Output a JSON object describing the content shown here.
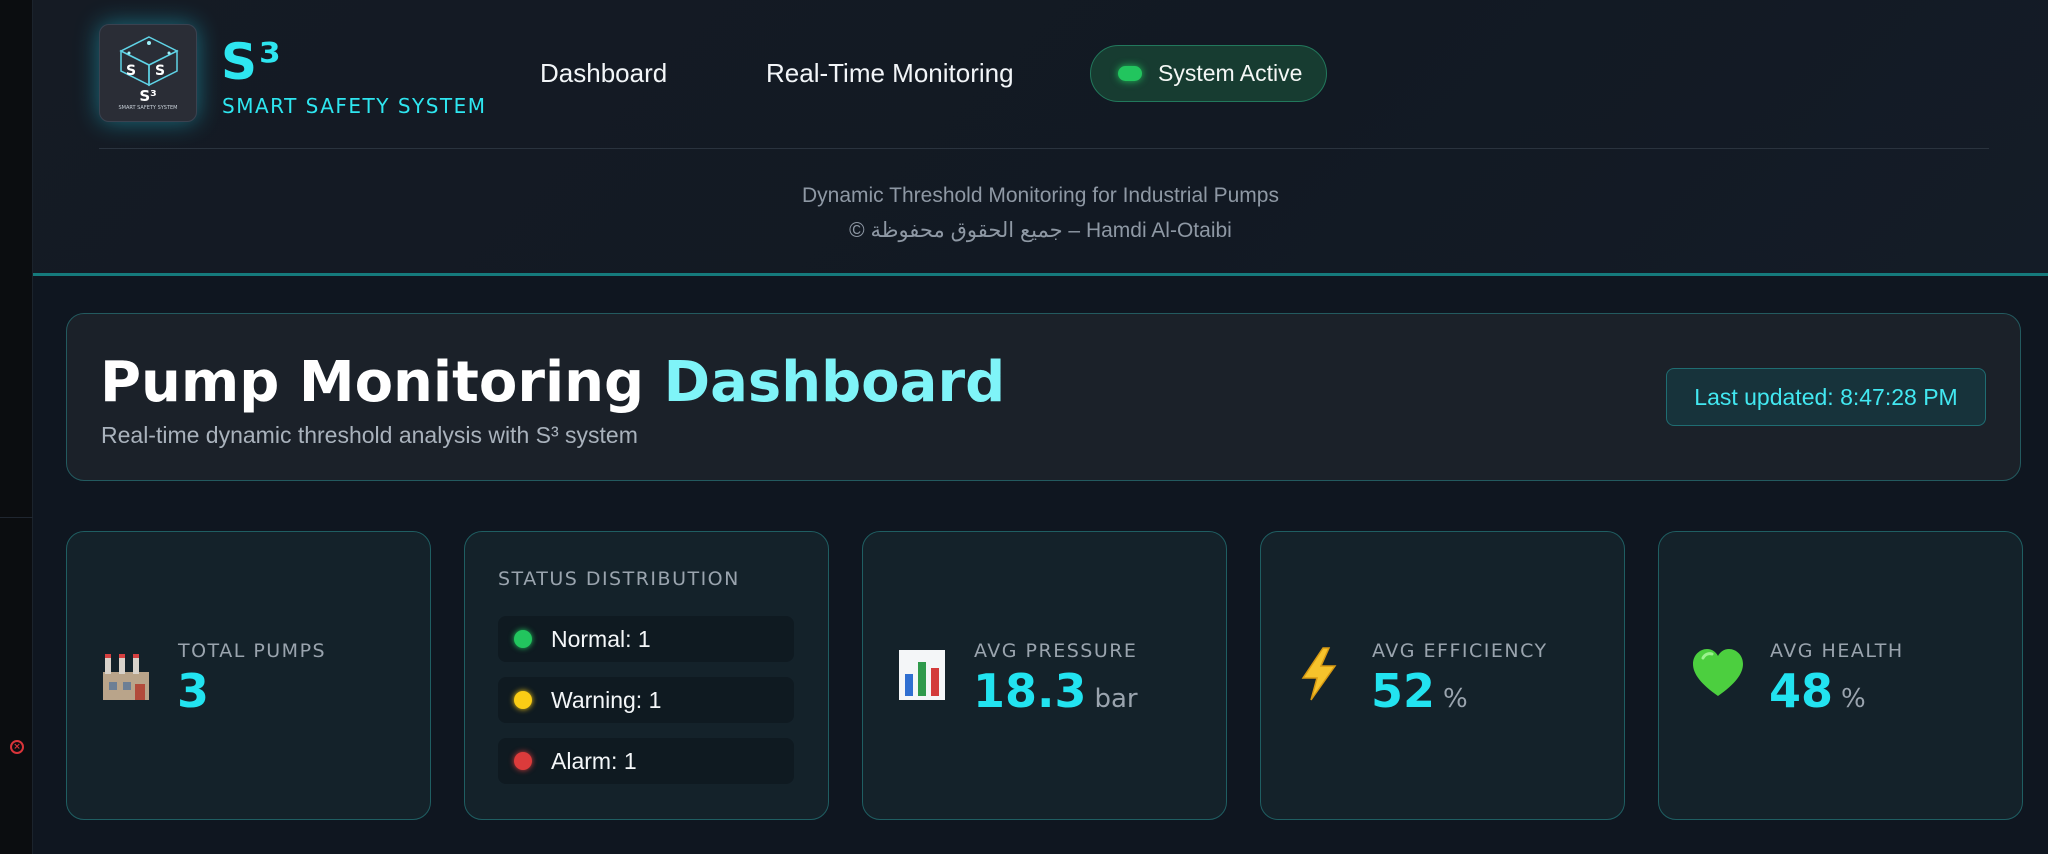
{
  "brand": {
    "logo_caption": "S³",
    "logo_small_text": "SMART SAFETY SYSTEM",
    "title": "S³",
    "subtitle": "SMART SAFETY SYSTEM"
  },
  "nav": {
    "dashboard": "Dashboard",
    "realtime": "Real-Time Monitoring"
  },
  "system_status": {
    "label": "System Active",
    "color": "#22c55e"
  },
  "header": {
    "tagline": "Dynamic Threshold Monitoring for Industrial Pumps",
    "copyright": "© جميع الحقوق محفوظة – Hamdi Al-Otaibi"
  },
  "hero": {
    "title_part1": "Pump Monitoring",
    "title_part2": "Dashboard",
    "subtitle": "Real-time dynamic threshold analysis with S³ system",
    "last_updated": "Last updated: 8:47:28 PM"
  },
  "stats": {
    "total_pumps": {
      "label": "TOTAL PUMPS",
      "value": "3",
      "icon": "factory-icon"
    },
    "distribution": {
      "label": "STATUS DISTRIBUTION",
      "items": [
        {
          "label": "Normal: 1",
          "color": "#22c55e"
        },
        {
          "label": "Warning: 1",
          "color": "#facc15"
        },
        {
          "label": "Alarm: 1",
          "color": "#dc3b3b"
        }
      ]
    },
    "avg_pressure": {
      "label": "AVG PRESSURE",
      "value": "18.3",
      "unit": "bar",
      "icon": "bar-chart-icon"
    },
    "avg_efficiency": {
      "label": "AVG EFFICIENCY",
      "value": "52",
      "unit": "%",
      "icon": "lightning-icon"
    },
    "avg_health": {
      "label": "AVG HEALTH",
      "value": "48",
      "unit": "%",
      "icon": "green-heart-icon"
    }
  },
  "colors": {
    "accent": "#22e3f0",
    "border": "#1f5e62",
    "header_rule": "#157a7c"
  }
}
